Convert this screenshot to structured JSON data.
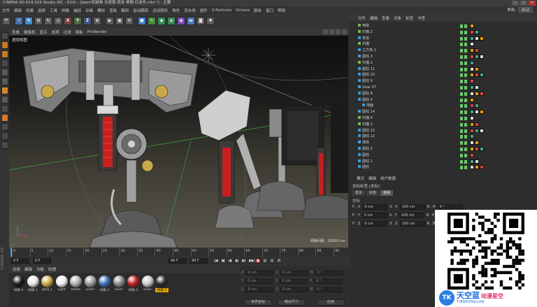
{
  "window": {
    "title": "CINEMA 4D R19.024 Studio (RC - R19) - [beer\\机械骨 无纸版 纸本 骨骼 红皮先.c4d *] - 主要",
    "buttons": [
      "—",
      "▢",
      "✕"
    ]
  },
  "menubar": {
    "items": [
      "文件",
      "编辑",
      "创建",
      "选择",
      "工具",
      "网格",
      "捕捉",
      "动画",
      "模拟",
      "渲染",
      "雕刻",
      "运动跟踪",
      "运动图形",
      "角色",
      "流水线",
      "插件",
      "X-Particles",
      "Octane",
      "脚本",
      "窗口",
      "帮助"
    ],
    "layout_label": "界面:",
    "layout_value": "启动"
  },
  "toolbar": {
    "icons": [
      {
        "name": "undo-icon",
        "glyph": "↶",
        "color": "#5a5a5a"
      },
      {
        "name": "select-icon",
        "glyph": "➚",
        "color": "#4a6fa5"
      },
      {
        "name": "move-icon",
        "glyph": "✥",
        "color": "#3f8fd1"
      },
      {
        "name": "scale-icon",
        "glyph": "⊡",
        "color": "#5a5a5a"
      },
      {
        "name": "rotate-icon",
        "glyph": "↻",
        "color": "#5a5a5a"
      },
      {
        "name": "recent-icon",
        "glyph": "◎",
        "color": "#5a5a5a"
      },
      {
        "name": "x-axis-icon",
        "glyph": "X",
        "color": "#7a4040"
      },
      {
        "name": "y-axis-icon",
        "glyph": "Y",
        "color": "#4a6a40"
      },
      {
        "name": "z-axis-icon",
        "glyph": "Z",
        "color": "#40507a"
      },
      {
        "name": "coord-icon",
        "glyph": "⊕",
        "color": "#5a5a5a"
      },
      {
        "name": "render-view-icon",
        "glyph": "▶",
        "color": "#5a5a5a"
      },
      {
        "name": "render-icon",
        "glyph": "▣",
        "color": "#5a5a5a"
      },
      {
        "name": "render-settings-icon",
        "glyph": "⚙",
        "color": "#5a5a5a"
      },
      {
        "name": "cube-icon",
        "glyph": "■",
        "color": "#3a7fd6"
      },
      {
        "name": "pen-icon",
        "glyph": "✎",
        "color": "#4a8a3a"
      },
      {
        "name": "subdivision-icon",
        "glyph": "◆",
        "color": "#3a8a5a"
      },
      {
        "name": "array-icon",
        "glyph": "◈",
        "color": "#3a8a5a"
      },
      {
        "name": "deformer-icon",
        "glyph": "◉",
        "color": "#7a4ab8"
      },
      {
        "name": "floor-icon",
        "glyph": "▬",
        "color": "#4a7ab8"
      },
      {
        "name": "camera-icon",
        "glyph": "◙",
        "color": "#5a5a5a"
      },
      {
        "name": "light-icon",
        "glyph": "✹",
        "color": "#5a5a5a"
      }
    ]
  },
  "leftbar": {
    "tools": [
      {
        "name": "make-editable-icon",
        "color": "#4a4a4a"
      },
      {
        "name": "model-mode-icon",
        "color": "#c77a2a"
      },
      {
        "name": "texture-mode-icon",
        "color": "#c77a2a"
      },
      {
        "name": "workplane-icon",
        "color": "#4a4a4a"
      },
      {
        "name": "points-mode-icon",
        "color": "#5a5a5a"
      },
      {
        "name": "edges-mode-icon",
        "color": "#5a5a5a"
      },
      {
        "name": "polygons-mode-icon",
        "color": "#d48a30"
      },
      {
        "name": "axis-mode-icon",
        "color": "#5a5a5a"
      },
      {
        "name": "tweak-mode-icon",
        "color": "#4a4a4a"
      },
      {
        "name": "snap-icon",
        "color": "#d47a30"
      },
      {
        "name": "lock-workplane-icon",
        "color": "#4a4a4a"
      },
      {
        "name": "solo-icon",
        "color": "#4a4a4a"
      },
      {
        "name": "python-icon",
        "color": "#4a4a4a"
      }
    ],
    "brand": "CINEMA 4D"
  },
  "viewport": {
    "menu": [
      "查看",
      "摄像机",
      "显示",
      "选项",
      "过滤",
      "面板",
      "ProRender"
    ],
    "label": "透视视图",
    "grid_info": "网格间距 : 10000 cm"
  },
  "timeline": {
    "ticks": [
      "0",
      "5",
      "10",
      "15",
      "20",
      "25",
      "30",
      "35",
      "40",
      "45",
      "50",
      "55",
      "60",
      "65",
      "70",
      "75",
      "80",
      "85",
      "90"
    ],
    "current_frame": "0 F",
    "start_frame": "0 F",
    "end_frame": "90 F",
    "current_frame_right": "90 F"
  },
  "transport": {
    "buttons": [
      "|◀",
      "◀|",
      "◀",
      "▶",
      "▶|",
      "▶▶|",
      "●",
      "◎",
      "⊙",
      "P"
    ]
  },
  "materials": {
    "menu": [
      "创建",
      "编辑",
      "功能",
      "纹理"
    ],
    "items": [
      {
        "label": "材质.4",
        "color": "#1a1a1a"
      },
      {
        "label": "材质.1",
        "color": "#e8e8e8"
      },
      {
        "label": "gold_1",
        "color": "#c9a84a"
      },
      {
        "label": "Light",
        "color": "#f0f0f0"
      },
      {
        "label": "Reflec",
        "color": "#b0b0b0"
      },
      {
        "label": "silver",
        "color": "#9a9a9a"
      },
      {
        "label": "材质.2",
        "color": "#3a6fb8"
      },
      {
        "label": "silver",
        "color": "#888888"
      },
      {
        "label": "材质.3",
        "color": "#c02020"
      },
      {
        "label": "silver",
        "color": "#c8c8c8"
      },
      {
        "label": "材质.2",
        "color": "#2a2a2a"
      }
    ]
  },
  "coords": {
    "rows": [
      {
        "a": "X",
        "av": "0 cm",
        "b": "X",
        "bv": "0 cm",
        "c": "H",
        "cv": "0 °"
      },
      {
        "a": "Y",
        "av": "0 cm",
        "b": "Y",
        "bv": "0 cm",
        "c": "P",
        "cv": "0 °"
      },
      {
        "a": "Z",
        "av": "0 cm",
        "b": "Z",
        "bv": "0 cm",
        "c": "B",
        "cv": "0 °"
      }
    ],
    "mode": "世界坐标",
    "size_mode": "绝对尺寸",
    "apply": "应用"
  },
  "objects": {
    "menu": [
      "文件",
      "编辑",
      "查看",
      "对象",
      "标签",
      "书签"
    ],
    "rows": [
      {
        "name": "电缆",
        "indent": 1,
        "color": "#7ac142"
      },
      {
        "name": "扫描.2",
        "indent": 1,
        "color": "#7ac142"
      },
      {
        "name": "管道",
        "indent": 1,
        "color": "#3aa0e0"
      },
      {
        "name": "扫描",
        "indent": 1,
        "color": "#7ac142"
      },
      {
        "name": "立方体.1",
        "indent": 1,
        "color": "#3aa0e0"
      },
      {
        "name": "圆柱.3",
        "indent": 1,
        "color": "#3aa0e0"
      },
      {
        "name": "扫描.1",
        "indent": 1,
        "color": "#7ac142"
      },
      {
        "name": "圆柱.11",
        "indent": 1,
        "color": "#3aa0e0"
      },
      {
        "name": "圆柱.10",
        "indent": 1,
        "color": "#3aa0e0"
      },
      {
        "name": "圆柱.9",
        "indent": 1,
        "color": "#3aa0e0"
      },
      {
        "name": "Gear 07",
        "indent": 1,
        "color": "#3aa0e0"
      },
      {
        "name": "圆柱.8",
        "indent": 1,
        "color": "#3aa0e0"
      },
      {
        "name": "圆柱.4",
        "indent": 1,
        "color": "#3aa0e0"
      },
      {
        "name": "地面",
        "indent": 2,
        "color": "#3aa0e0"
      },
      {
        "name": "圆柱.14",
        "indent": 1,
        "color": "#3aa0e0"
      },
      {
        "name": "扫描.4",
        "indent": 1,
        "color": "#7ac142"
      },
      {
        "name": "扫描.3",
        "indent": 1,
        "color": "#7ac142"
      },
      {
        "name": "圆柱.13",
        "indent": 1,
        "color": "#3aa0e0"
      },
      {
        "name": "圆柱.12",
        "indent": 1,
        "color": "#3aa0e0"
      },
      {
        "name": "球体",
        "indent": 1,
        "color": "#3aa0e0"
      },
      {
        "name": "圆柱.5",
        "indent": 1,
        "color": "#3aa0e0"
      },
      {
        "name": "圆柱",
        "indent": 1,
        "color": "#3aa0e0"
      },
      {
        "name": "圆柱.1",
        "indent": 1,
        "color": "#3aa0e0"
      },
      {
        "name": "圆柱",
        "indent": 1,
        "color": "#3aa0e0"
      }
    ]
  },
  "attributes": {
    "menu": [
      "模式",
      "编辑",
      "用户数据"
    ],
    "title": "坐标标签 [坐标]",
    "tabs": [
      "基本",
      "标签",
      "坐标"
    ],
    "active_tab": "坐标",
    "section": "坐标",
    "rows": [
      {
        "p": "P . X",
        "pv": "0 cm",
        "s": "S . X",
        "sv": "100 cm",
        "r": "R . H",
        "rv": "0 °"
      },
      {
        "p": "P . Y",
        "pv": "0 cm",
        "s": "S . Y",
        "sv": "100 cm",
        "r": "R . P",
        "rv": "0 °"
      },
      {
        "p": "P . Z",
        "pv": "0 cm",
        "s": "S . Z",
        "sv": "100 cm",
        "r": "R . B",
        "rv": "0 °"
      }
    ]
  },
  "watermark": {
    "logo": "TK",
    "name": "天空蓝",
    "tag": "动漫星空",
    "sub": "TIANKONGLAN"
  }
}
